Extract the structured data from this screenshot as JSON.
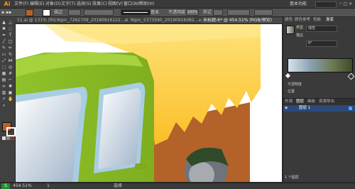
{
  "menubar": {
    "logo": "Ai",
    "items": [
      "文件(F)",
      "编辑(E)",
      "对象(O)",
      "文字(T)",
      "选择(S)",
      "效果(C)",
      "视图(V)",
      "窗口(W)",
      "帮助(H)"
    ],
    "workspace": "基本功能"
  },
  "control": {
    "stroke_label": "描边",
    "brush_label": "基本",
    "opacity_label": "不透明度",
    "opacity_value": "100%",
    "style_label": "样式"
  },
  "tabs": [
    {
      "label": "51.ai @ 131% (RGB/预览)",
      "active": false
    },
    {
      "label": "Nipic_7262709_20190916122...ai",
      "active": false
    },
    {
      "label": "Nipic_5373590_20190916082...ai",
      "active": false
    },
    {
      "label": "未标题-6* @ 454.51% (RGB/预览)",
      "active": true
    }
  ],
  "right_panel": {
    "top_tabs": [
      "颜色",
      "颜色参考",
      "色板",
      "渐变"
    ],
    "type_label": "类型",
    "type_value": "线性",
    "stroke_label": "描边",
    "angle_value": "0°",
    "opacity_label": "不透明度",
    "location_label": "位置",
    "layers_tabs": [
      "外观",
      "图层",
      "画板",
      "资源导出"
    ],
    "layer_name": "图层 1",
    "layers_count": "1 个图层"
  },
  "status": {
    "zoom": "454.51%",
    "page": "1",
    "tool": "选择"
  },
  "colors": {
    "bg": "#2b2b2b",
    "truck_green": "#8fbf25",
    "tarp_yellow": "#fbc02d",
    "mud_brown": "#b4632a"
  },
  "icons": [
    "selection-tool-icon",
    "direct-selection-tool-icon",
    "magic-wand-icon",
    "lasso-icon",
    "pen-tool-icon",
    "type-tool-icon",
    "line-tool-icon",
    "rectangle-tool-icon",
    "paintbrush-icon",
    "pencil-icon",
    "eraser-icon",
    "rotate-icon",
    "scale-icon",
    "width-tool-icon",
    "free-transform-icon",
    "shape-builder-icon",
    "perspective-grid-icon",
    "mesh-tool-icon",
    "gradient-tool-icon",
    "eyedropper-icon",
    "blend-tool-icon",
    "symbol-sprayer-icon",
    "graph-tool-icon",
    "artboard-tool-icon",
    "slice-tool-icon",
    "hand-tool-icon",
    "zoom-tool-icon"
  ]
}
